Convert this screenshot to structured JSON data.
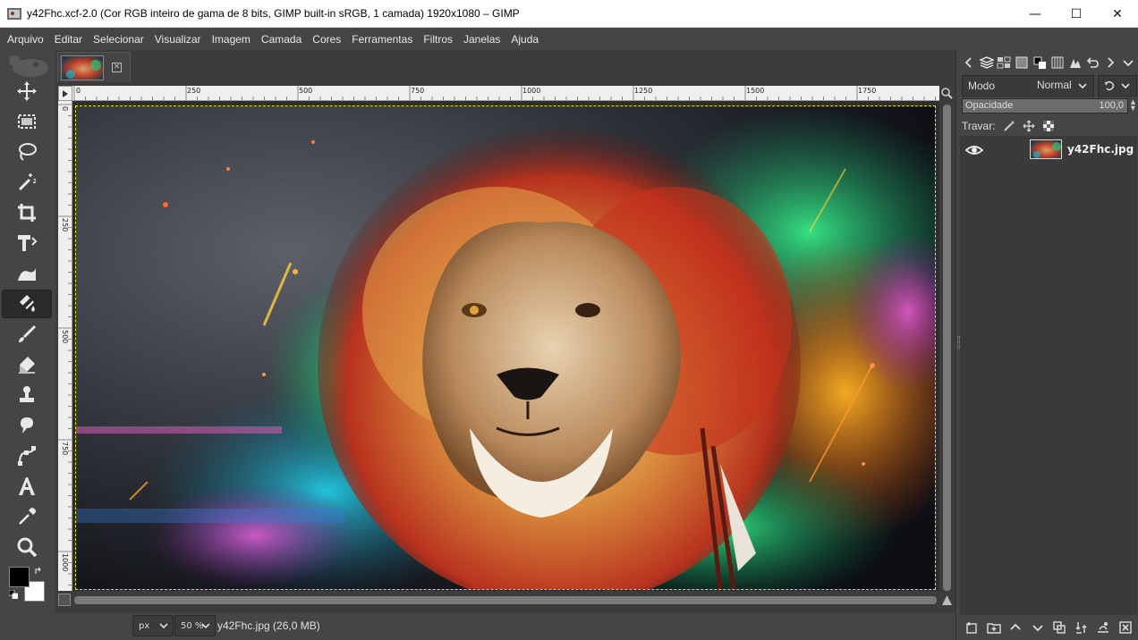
{
  "window": {
    "title": "y42Fhc.xcf-2.0 (Cor RGB inteiro de gama de 8 bits, GIMP built-in sRGB, 1 camada) 1920x1080 – GIMP",
    "minimize_glyph": "—",
    "maximize_glyph": "☐",
    "close_glyph": "✕"
  },
  "menu": [
    "Arquivo",
    "Editar",
    "Selecionar",
    "Visualizar",
    "Imagem",
    "Camada",
    "Cores",
    "Ferramentas",
    "Filtros",
    "Janelas",
    "Ajuda"
  ],
  "toolbox": {
    "tools": [
      {
        "name": "move-tool",
        "icon": "move-icon"
      },
      {
        "name": "rect-select-tool",
        "icon": "rect-select-icon"
      },
      {
        "name": "lasso-tool",
        "icon": "lasso-icon"
      },
      {
        "name": "fuzzy-select-tool",
        "icon": "magic-wand-icon"
      },
      {
        "name": "crop-tool",
        "icon": "crop-icon"
      },
      {
        "name": "unified-transform-tool",
        "icon": "transform-icon"
      },
      {
        "name": "warp-transform-tool",
        "icon": "warp-icon"
      },
      {
        "name": "bucket-fill-tool",
        "icon": "bucket-fill-icon"
      },
      {
        "name": "paintbrush-tool",
        "icon": "paintbrush-icon"
      },
      {
        "name": "eraser-tool",
        "icon": "eraser-icon"
      },
      {
        "name": "clone-tool",
        "icon": "clone-stamp-icon"
      },
      {
        "name": "smudge-tool",
        "icon": "smudge-icon"
      },
      {
        "name": "paths-tool",
        "icon": "paths-icon"
      },
      {
        "name": "text-tool",
        "icon": "text-icon"
      },
      {
        "name": "color-picker-tool",
        "icon": "color-picker-icon"
      },
      {
        "name": "zoom-tool",
        "icon": "zoom-icon"
      }
    ],
    "active_tool": "bucket-fill-tool",
    "fg_color": "#000000",
    "bg_color": "#ffffff"
  },
  "rulers": {
    "horizontal": [
      "0",
      "250",
      "500",
      "750",
      "1000",
      "1250",
      "1500",
      "1750"
    ],
    "vertical": [
      "0",
      "250",
      "500",
      "750",
      "1000"
    ]
  },
  "status": {
    "unit": "px",
    "zoom": "50 %",
    "file_info": "y42Fhc.jpg (26,0 MB)"
  },
  "layers_panel": {
    "mode_label": "Modo",
    "mode_value": "Normal",
    "opacity_label": "Opacidade",
    "opacity_value": "100,0",
    "opacity_fraction": 1.0,
    "lock_label": "Travar:",
    "layer_name": "y42Fhc.jpg"
  }
}
